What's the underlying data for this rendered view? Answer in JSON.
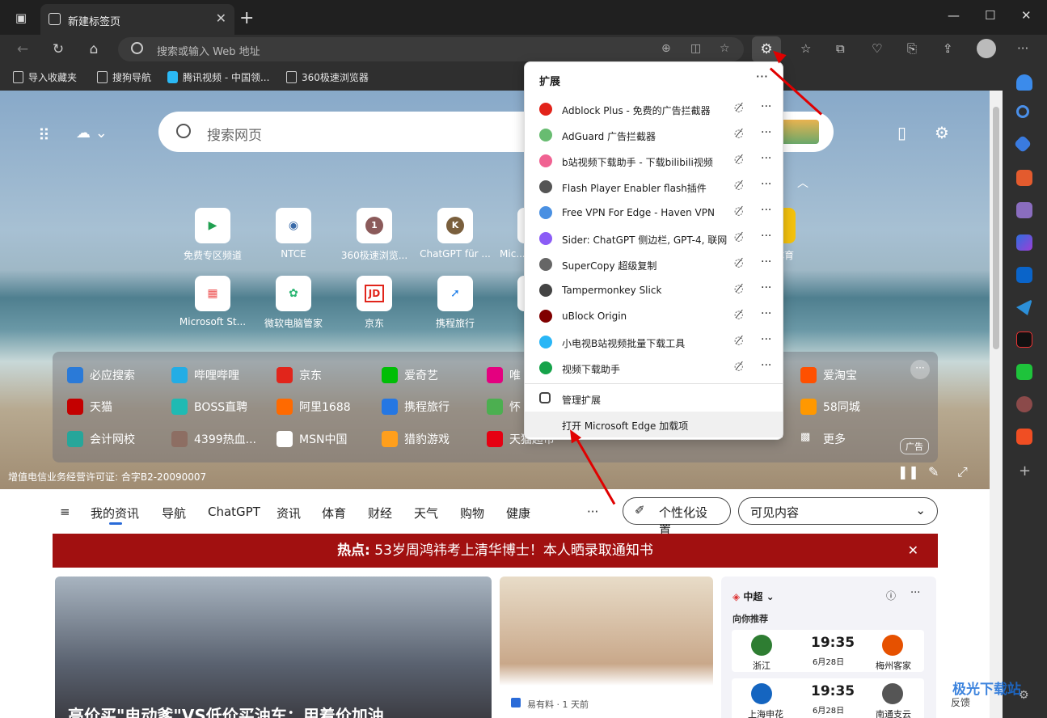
{
  "browser": {
    "tab_title": "新建标签页",
    "address_placeholder": "搜索或输入 Web 地址"
  },
  "bookmarks": [
    "导入收藏夹",
    "搜狗导航",
    "腾讯视频 - 中国领...",
    "360极速浏览器"
  ],
  "newtab": {
    "search_placeholder": "搜索网页",
    "tiles_row1": [
      "免费专区频道",
      "NTCE",
      "360极速浏览...",
      "ChatGPT für ...",
      "Mic...",
      "体育"
    ],
    "tiles_row2": [
      "Microsoft St...",
      "微软电脑管家",
      "京东",
      "携程旅行"
    ],
    "tile_icon_text": {
      "t360": "1",
      "chatgpt": "K",
      "jd": "JD"
    },
    "links": [
      [
        "必应搜索",
        "哔哩哔哩",
        "京东",
        "爱奇艺",
        "唯",
        "爱淘宝"
      ],
      [
        "天猫",
        "BOSS直聘",
        "阿里1688",
        "携程旅行",
        "怀",
        "58同城"
      ],
      [
        "会计网校",
        "4399热血...",
        "MSN中国",
        "猎豹游戏",
        "天猫超市",
        "更多"
      ]
    ],
    "ad_tag": "广告",
    "license": "增值电信业务经营许可证: 合字B2-20090007"
  },
  "feed": {
    "nav": [
      "我的资讯",
      "导航",
      "ChatGPT",
      "资讯",
      "体育",
      "财经",
      "天气",
      "购物",
      "健康"
    ],
    "more": "···",
    "personalize": "个性化设置",
    "visible": "可见内容",
    "hot_label": "热点:",
    "hot_text": "53岁周鸿祎考上清华博士！本人晒录取通知书",
    "card2_source": "易有料 · 1 天前",
    "card1_headline": "高价买\"电动爹\"VS低价买油车：用着价加油",
    "sport": {
      "league": "中超",
      "rec": "向你推荐",
      "m1": {
        "home": "浙江",
        "away": "梅州客家",
        "time": "19:35",
        "date": "6月28日"
      },
      "m2": {
        "home": "上海申花",
        "away": "南通支云",
        "time": "19:35",
        "date": "6月28日"
      },
      "feedback": "反馈"
    }
  },
  "extensions": {
    "title": "扩展",
    "items": [
      "Adblock Plus - 免费的广告拦截器",
      "AdGuard 广告拦截器",
      "b站视频下载助手 - 下载bilibili视频",
      "Flash Player Enabler flash插件",
      "Free VPN For Edge - Haven VPN",
      "Sider: ChatGPT 侧边栏, GPT-4, 联网",
      "SuperCopy 超级复制",
      "Tampermonkey Slick",
      "uBlock Origin",
      "小电视B站视频批量下载工具",
      "视频下载助手"
    ],
    "icon_colors": [
      "#e2231a",
      "#68bc71",
      "#f06292",
      "#555555",
      "#4a90e2",
      "#8b5cf6",
      "#666666",
      "#444444",
      "#800000",
      "#29b6f6",
      "#16a34a"
    ],
    "manage": "管理扩展",
    "open_addons": "打开 Microsoft Edge 加载项"
  },
  "watermark": "极光下载站"
}
